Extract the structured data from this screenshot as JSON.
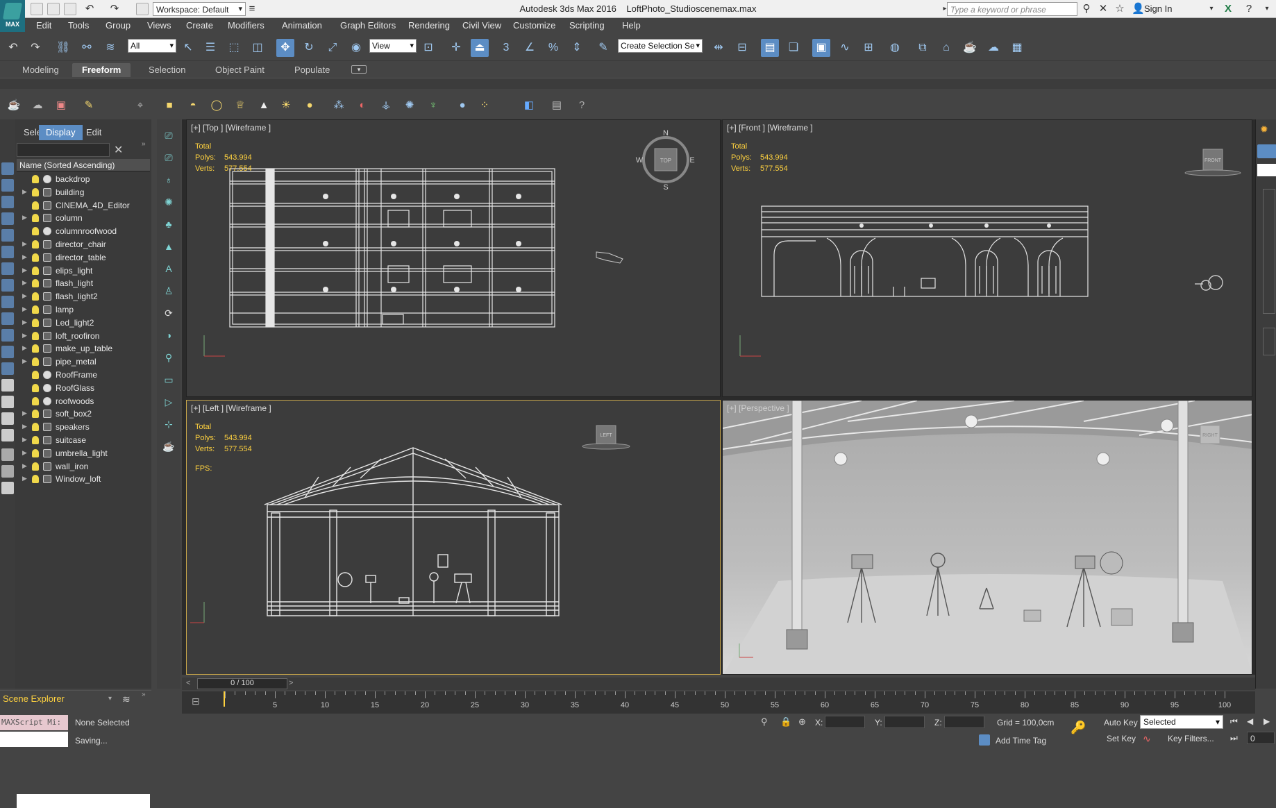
{
  "app": {
    "title": "Autodesk 3ds Max 2016",
    "file": "LoftPhoto_Studioscenemax.max",
    "logo": "MAX",
    "workspace": "Workspace: Default",
    "search_placeholder": "Type a keyword or phrase",
    "sign_in": "Sign In"
  },
  "menu": [
    "Edit",
    "Tools",
    "Group",
    "Views",
    "Create",
    "Modifiers",
    "Animation",
    "Graph Editors",
    "Rendering",
    "Civil View",
    "Customize",
    "Scripting",
    "Help"
  ],
  "toolbar": {
    "filter": "All",
    "ref_coord": "View",
    "selection_set": "Create Selection Se"
  },
  "ribbon_tabs": [
    "Modeling",
    "Freeform",
    "Selection",
    "Object Paint",
    "Populate"
  ],
  "ribbon_active": "Freeform",
  "explorer": {
    "tabs": [
      "Select",
      "Display",
      "Edit"
    ],
    "active_tab": "Display",
    "column_header": "Name (Sorted Ascending)",
    "items": [
      {
        "name": "backdrop",
        "expand": false,
        "kind": "sphere"
      },
      {
        "name": "building",
        "expand": true,
        "kind": "box"
      },
      {
        "name": "CINEMA_4D_Editor",
        "expand": false,
        "kind": "cam"
      },
      {
        "name": "column",
        "expand": true,
        "kind": "box"
      },
      {
        "name": "columnroofwood",
        "expand": false,
        "kind": "sphere"
      },
      {
        "name": "director_chair",
        "expand": true,
        "kind": "box"
      },
      {
        "name": "director_table",
        "expand": true,
        "kind": "box"
      },
      {
        "name": "elips_light",
        "expand": true,
        "kind": "box"
      },
      {
        "name": "flash_light",
        "expand": true,
        "kind": "box"
      },
      {
        "name": "flash_light2",
        "expand": true,
        "kind": "box"
      },
      {
        "name": "lamp",
        "expand": true,
        "kind": "box"
      },
      {
        "name": "Led_light2",
        "expand": true,
        "kind": "box"
      },
      {
        "name": "loft_roofiron",
        "expand": true,
        "kind": "box"
      },
      {
        "name": "make_up_table",
        "expand": true,
        "kind": "box"
      },
      {
        "name": "pipe_metal",
        "expand": true,
        "kind": "box"
      },
      {
        "name": "RoofFrame",
        "expand": false,
        "kind": "sphere"
      },
      {
        "name": "RoofGlass",
        "expand": false,
        "kind": "sphere"
      },
      {
        "name": "roofwoods",
        "expand": false,
        "kind": "sphere"
      },
      {
        "name": "soft_box2",
        "expand": true,
        "kind": "box"
      },
      {
        "name": "speakers",
        "expand": true,
        "kind": "box"
      },
      {
        "name": "suitcase",
        "expand": true,
        "kind": "box"
      },
      {
        "name": "umbrella_light",
        "expand": true,
        "kind": "box"
      },
      {
        "name": "wall_iron",
        "expand": true,
        "kind": "box"
      },
      {
        "name": "Window_loft",
        "expand": true,
        "kind": "box"
      }
    ],
    "footer_label": "Scene Explorer"
  },
  "viewports": {
    "top": {
      "label": "[+] [Top ] [Wireframe ]",
      "cube": "TOP",
      "compass": [
        "N",
        "E",
        "S",
        "W"
      ]
    },
    "front": {
      "label": "[+] [Front ] [Wireframe ]",
      "cube": "FRONT"
    },
    "left": {
      "label": "[+] [Left ] [Wireframe ]",
      "cube": "LEFT",
      "fps": "FPS:"
    },
    "perspective": {
      "label": "[+] [Perspective ]",
      "cube": "RIGHT"
    }
  },
  "stats": {
    "total": "Total",
    "polys_label": "Polys:",
    "polys": "543.994",
    "verts_label": "Verts:",
    "verts": "577.554"
  },
  "timeslider": {
    "label": "0 / 100",
    "ticks": [
      "5",
      "10",
      "15",
      "20",
      "25",
      "30",
      "35",
      "40",
      "45",
      "50",
      "55",
      "60",
      "65",
      "70",
      "75",
      "80",
      "85",
      "90",
      "95",
      "100"
    ]
  },
  "status": {
    "maxscript": "MAXScript Mi:",
    "selection": "None Selected",
    "prompt": "Saving...",
    "x_label": "X:",
    "y_label": "Y:",
    "z_label": "Z:",
    "grid": "Grid = 100,0cm",
    "add_time_tag": "Add Time Tag",
    "auto_key": "Auto Key",
    "set_key": "Set Key",
    "key_mode": "Selected",
    "key_filters": "Key Filters...",
    "frame": "0"
  },
  "colors": {
    "accent": "#5c8dc4",
    "stats": "#ffd23f",
    "active_border": "#c9a74a",
    "wire": "#e6e6e6"
  }
}
